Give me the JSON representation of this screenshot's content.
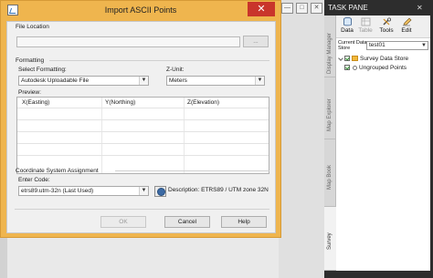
{
  "dialog": {
    "title": "Import ASCII Points",
    "close_glyph": "✕",
    "file_location_label": "File Location",
    "browse_label": "...",
    "formatting_label": "Formatting",
    "select_formatting_label": "Select Formatting:",
    "select_formatting_value": "Autodesk Uploadable File",
    "z_unit_label": "Z-Unit:",
    "z_unit_value": "Meters",
    "preview_label": "Preview:",
    "preview_columns": [
      "X(Easting)",
      "Y(Northing)",
      "Z(Elevation)"
    ],
    "coord_label": "Coordinate System Assignment",
    "enter_code_label": "Enter Code:",
    "code_value": "etrs89.utm-32n (Last Used)",
    "description": "Description: ETRS89 / UTM zone 32N",
    "buttons": {
      "ok": "OK",
      "cancel": "Cancel",
      "help": "Help"
    }
  },
  "taskpane": {
    "title": "TASK PANE",
    "close_glyph": "✕",
    "side_tabs": [
      "Display Manager",
      "Map Explorer",
      "Map Book",
      "Survey"
    ],
    "toolbar": [
      {
        "label": "Data",
        "icon": "database-icon",
        "enabled": true
      },
      {
        "label": "Table",
        "icon": "table-icon",
        "enabled": false
      },
      {
        "label": "Tools",
        "icon": "tools-icon",
        "enabled": true
      },
      {
        "label": "Edit",
        "icon": "edit-icon",
        "enabled": true
      }
    ],
    "current_store_label_1": "Current Data",
    "current_store_label_2": "Store",
    "current_store_value": "test01",
    "tree": [
      {
        "label": "Survey Data Store",
        "level": 0
      },
      {
        "label": "Ungrouped Points",
        "level": 1
      }
    ]
  },
  "background": {
    "icons": [
      "minimize-icon",
      "restore-icon",
      "close-icon"
    ]
  }
}
